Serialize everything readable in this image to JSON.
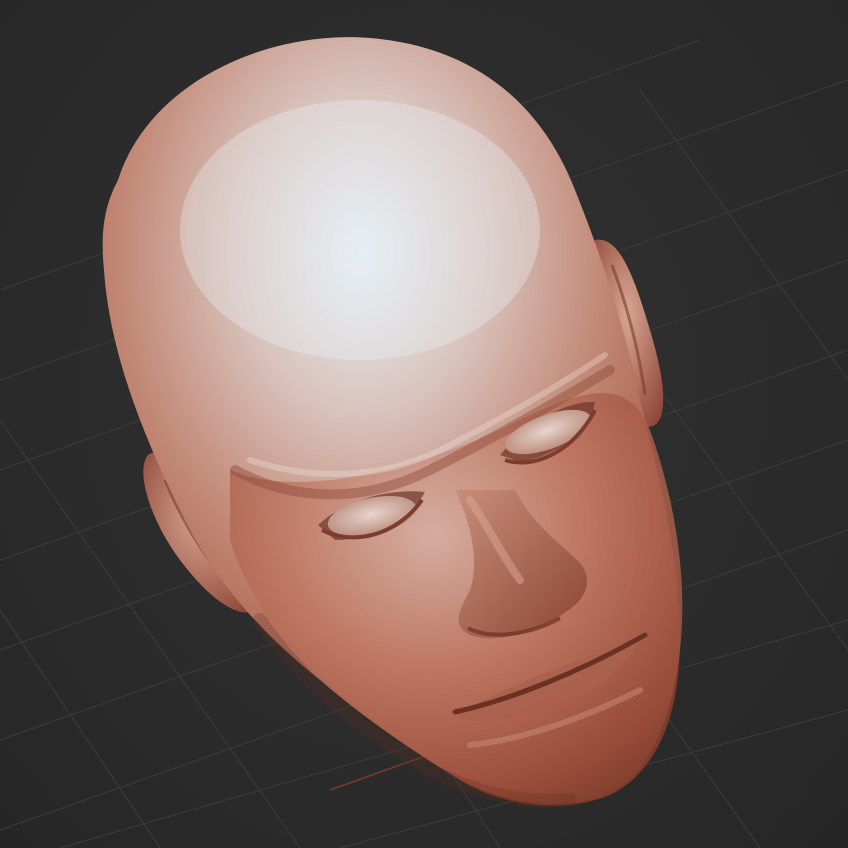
{
  "viewport": {
    "background_color": "#2b2b2b",
    "grid_color": "#3a3a3a",
    "axis_color": "#7a3a2a",
    "grid_visible": true
  },
  "model": {
    "subject": "head-sculpt",
    "material_color": "#b86a55",
    "highlight_color": "#e3ecf2",
    "shadow_color": "#6e3426"
  }
}
